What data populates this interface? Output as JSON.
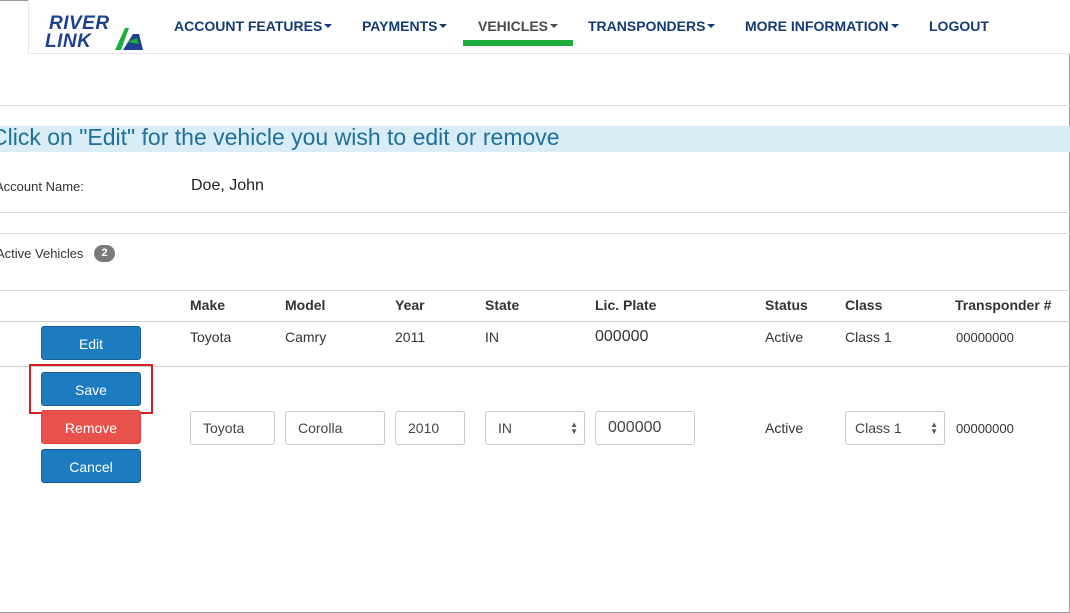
{
  "nav": {
    "logo": {
      "line1": "RIVER",
      "line2": "LINK"
    },
    "items": [
      {
        "label": "ACCOUNT FEATURES",
        "caret": true
      },
      {
        "label": "PAYMENTS",
        "caret": true
      },
      {
        "label": "VEHICLES",
        "caret": true,
        "active": true
      },
      {
        "label": "TRANSPONDERS",
        "caret": true
      },
      {
        "label": "MORE INFORMATION",
        "caret": true
      },
      {
        "label": "LOGOUT",
        "caret": false
      }
    ],
    "active_color": "#1cad3a"
  },
  "banner": {
    "text": "Click on \"Edit\" for the vehicle you wish to edit or remove"
  },
  "account": {
    "label": "Account Name:",
    "value": "Doe, John"
  },
  "active_vehicles": {
    "label": "Active Vehicles",
    "count": "2"
  },
  "table": {
    "headers": [
      "Make",
      "Model",
      "Year",
      "State",
      "Lic. Plate",
      "Status",
      "Class",
      "Transponder #"
    ],
    "row1": {
      "edit_label": "Edit",
      "make": "Toyota",
      "model": "Camry",
      "year": "2011",
      "state": "IN",
      "plate": "000000",
      "status": "Active",
      "class": "Class 1",
      "transponder": "00000000"
    },
    "row2": {
      "save_label": "Save",
      "remove_label": "Remove",
      "cancel_label": "Cancel",
      "make": "Toyota",
      "model": "Corolla",
      "year": "2010",
      "state": "IN",
      "plate": "000000",
      "status": "Active",
      "class": "Class 1",
      "transponder": "00000000"
    }
  },
  "colors": {
    "primary": "#1d7bbf",
    "danger": "#e9524c",
    "highlight": "#d51f26",
    "banner_bg": "#d9edf7",
    "banner_text": "#1f6f9b",
    "nav_text": "#163a74"
  }
}
